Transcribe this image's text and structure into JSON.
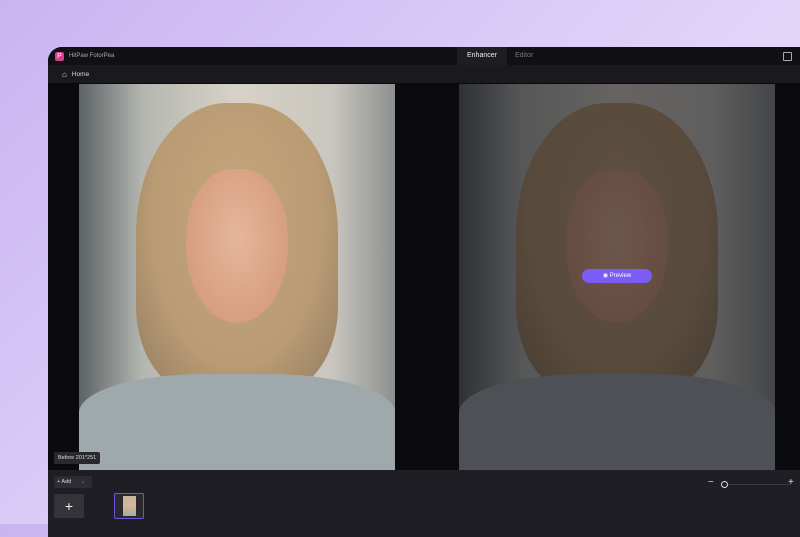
{
  "app": {
    "title": "HitPaw FotorPea"
  },
  "tabs": [
    {
      "label": "Enhancer",
      "active": true
    },
    {
      "label": "Editor",
      "active": false
    }
  ],
  "nav": {
    "home": "Home"
  },
  "viewer": {
    "before_label": "Before 201*251",
    "preview_label": "Preview"
  },
  "bottom": {
    "add_label": "+ Add",
    "add_dropdown": "⌄",
    "add_tile": "+",
    "zoom_minus": "−",
    "zoom_plus": "+",
    "zoom_level": 0.0
  },
  "colors": {
    "accent": "#7b5cf5"
  }
}
